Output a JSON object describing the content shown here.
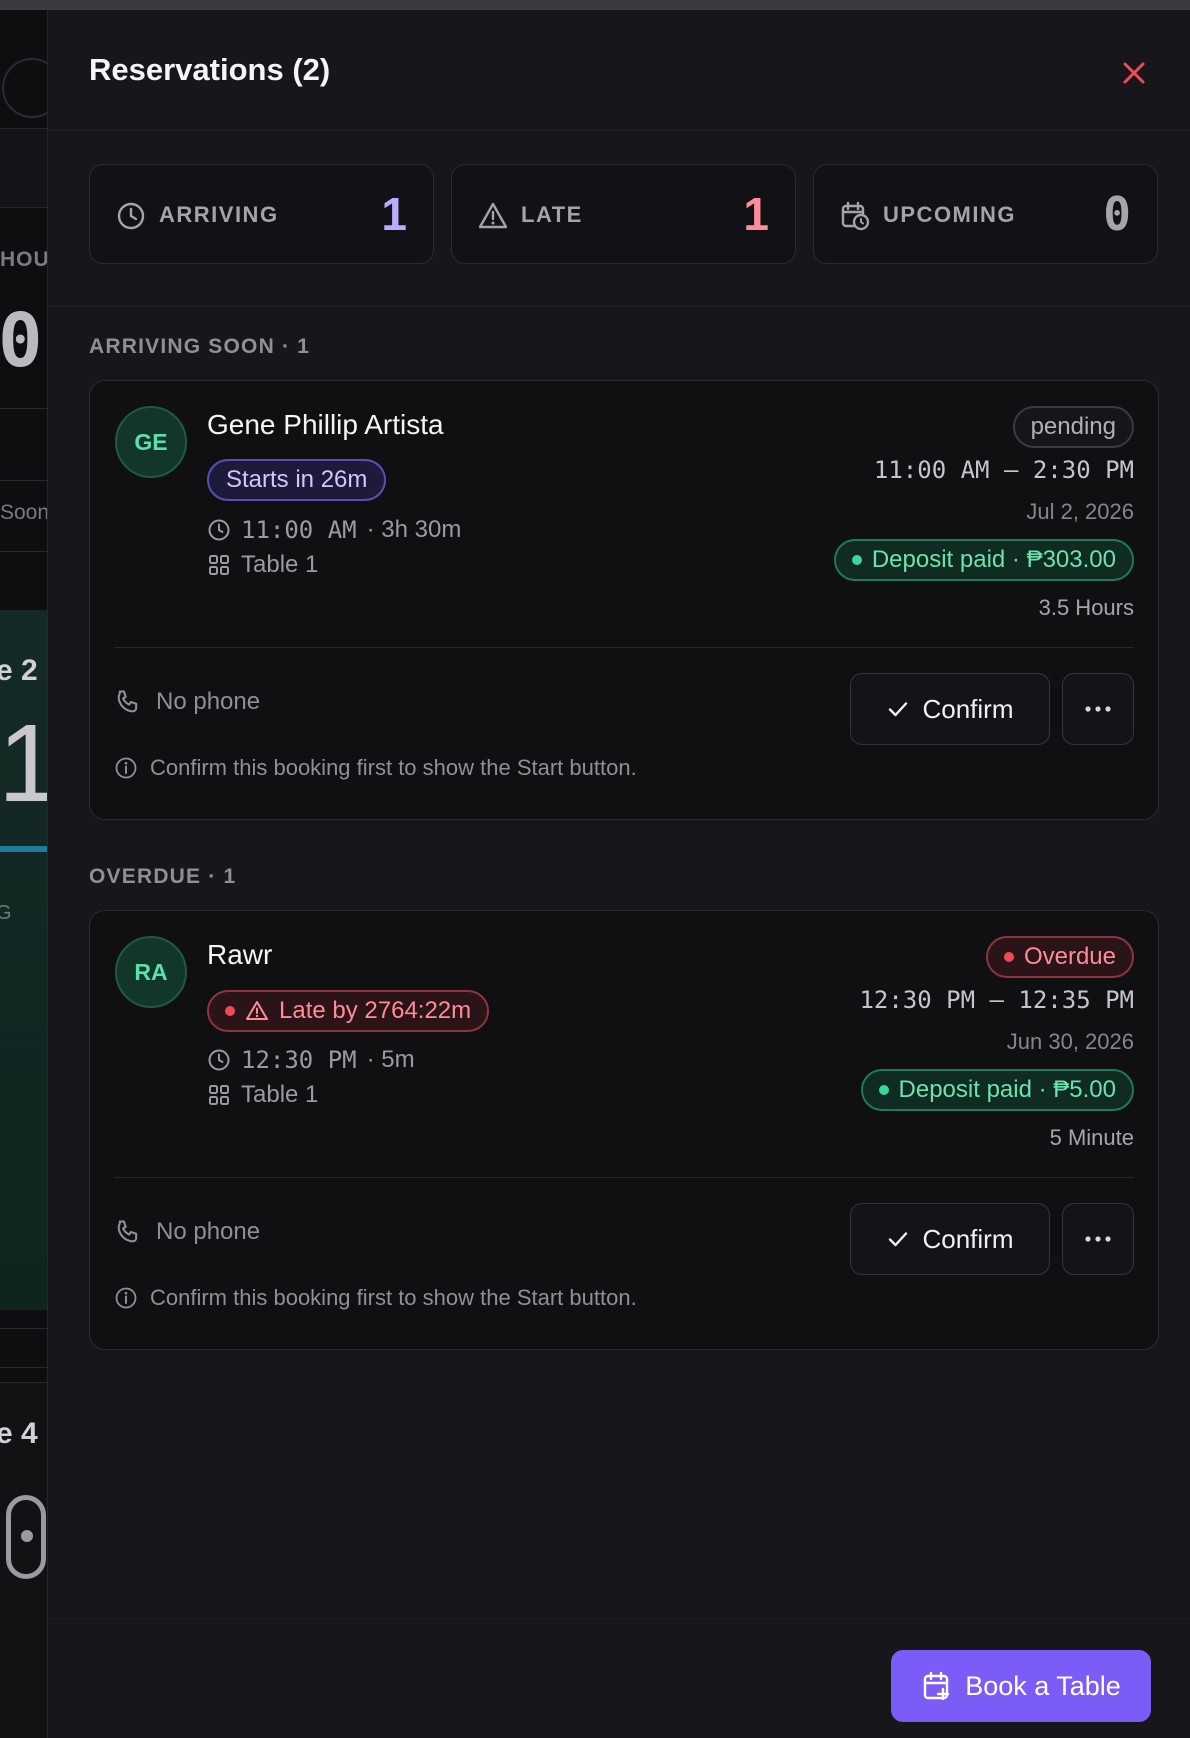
{
  "background_app": {
    "label_hou": "HOU",
    "big_0": "0",
    "label_soon": "Soon",
    "label_e2": "e 2",
    "big_1": "1",
    "label_g": "G",
    "label_e4": "e 4",
    "accent": "#1f6f8f"
  },
  "drawer": {
    "title": "Reservations (2)",
    "colors": {
      "accent": "#7c5cf6",
      "danger": "#ef4b55",
      "success": "#3dd598"
    }
  },
  "stats": [
    {
      "label": "ARRIVING",
      "value": "1",
      "icon": "clock-icon",
      "color": "#b8adff"
    },
    {
      "label": "LATE",
      "value": "1",
      "icon": "alert-triangle-icon",
      "color": "#ff8c9a"
    },
    {
      "label": "UPCOMING",
      "value": "0",
      "icon": "calendar-clock-icon",
      "color": "#a5a5ae"
    }
  ],
  "sections": [
    {
      "title": "ARRIVING SOON · 1",
      "card": {
        "initials": "GE",
        "name": "Gene Phillip Artista",
        "chip": "Starts in 26m",
        "time_short": "11:00 AM",
        "duration_short": "· 3h 30m",
        "table": "Table 1",
        "status": "pending",
        "time_range": "11:00 AM – 2:30 PM",
        "date": "Jul 2, 2026",
        "deposit": "Deposit paid · ₱303.00",
        "duration_label": "3.5 Hours",
        "phone": "No phone",
        "confirm_label": "Confirm",
        "hint": "Confirm this booking first to show the Start button."
      }
    },
    {
      "title": "OVERDUE · 1",
      "card": {
        "initials": "RA",
        "name": "Rawr",
        "chip": "Late by 2764:22m",
        "time_short": "12:30 PM",
        "duration_short": "· 5m",
        "table": "Table 1",
        "status": "Overdue",
        "time_range": "12:30 PM – 12:35 PM",
        "date": "Jun 30, 2026",
        "deposit": "Deposit paid · ₱5.00",
        "duration_label": "5 Minute",
        "phone": "No phone",
        "confirm_label": "Confirm",
        "hint": "Confirm this booking first to show the Start button."
      }
    }
  ],
  "footer": {
    "book_label": "Book a Table"
  }
}
